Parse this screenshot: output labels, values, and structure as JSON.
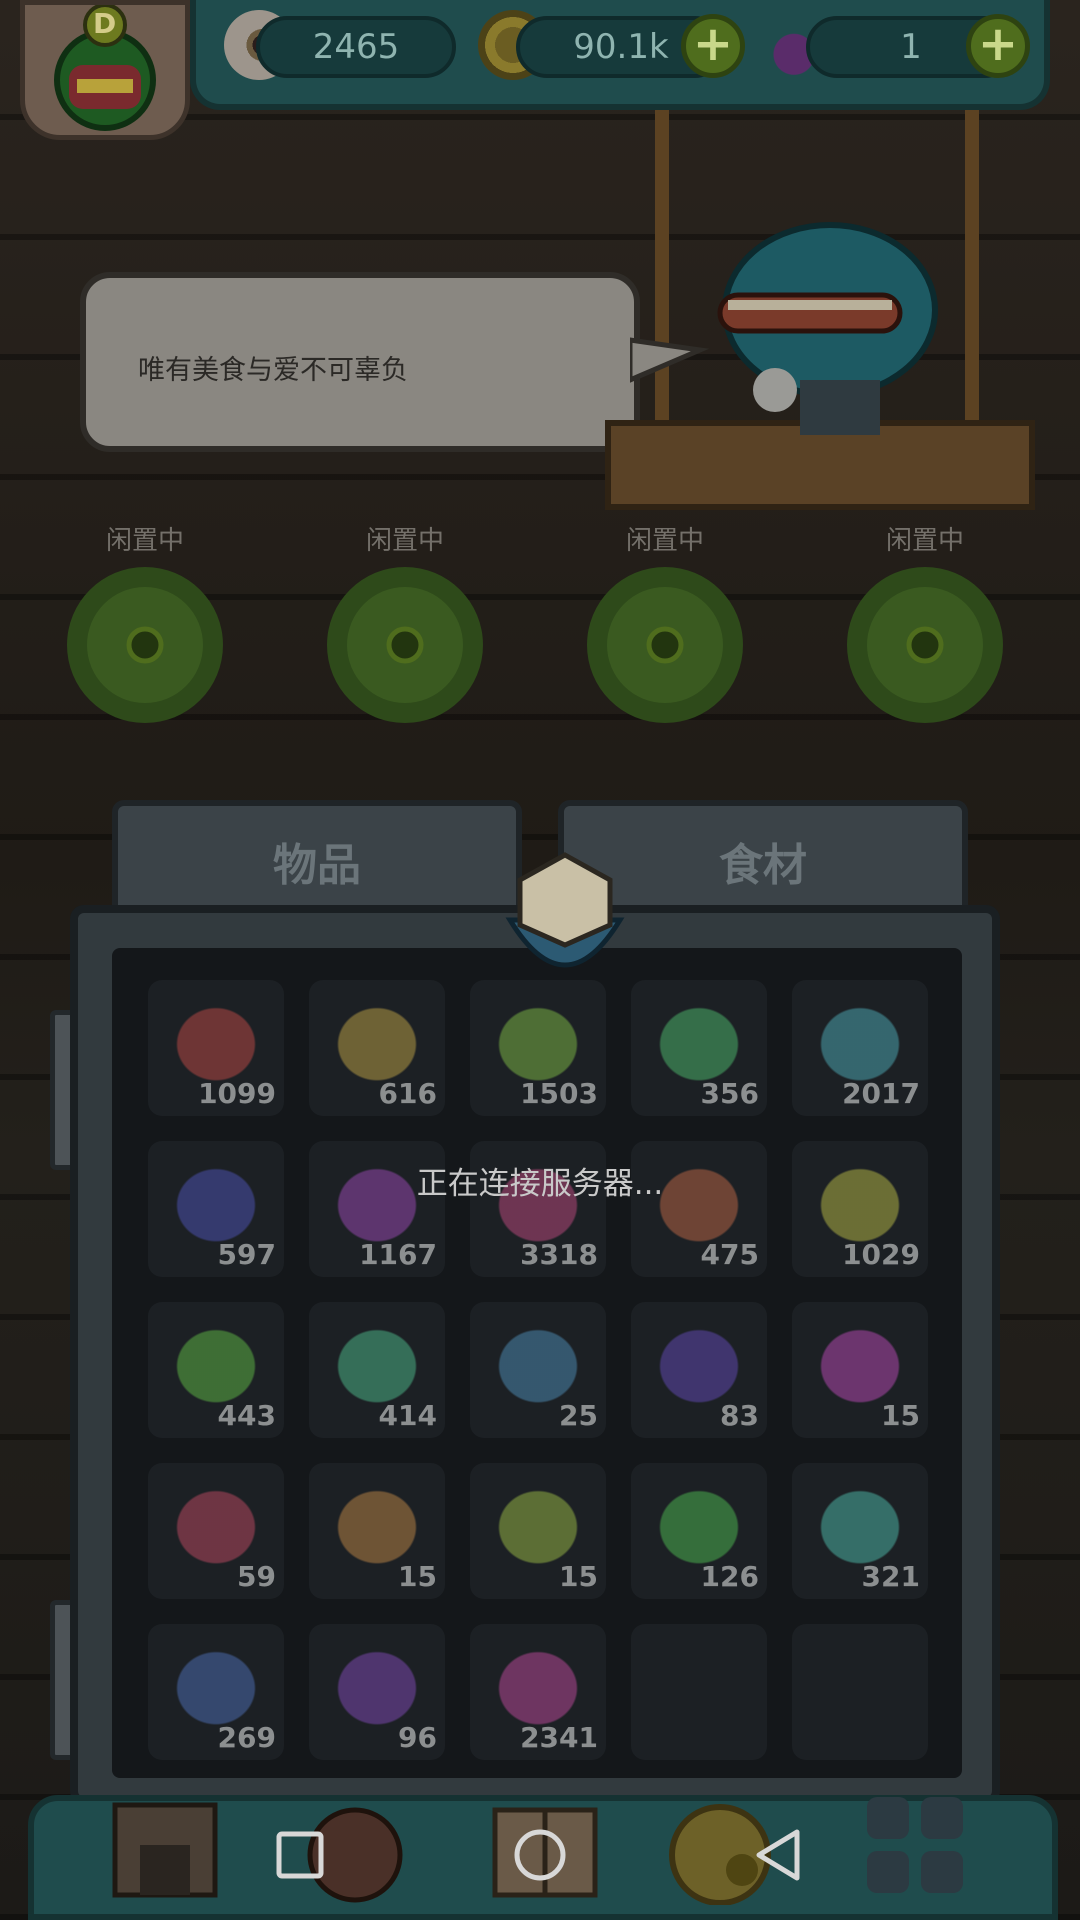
{
  "resources": {
    "eyes": "2465",
    "coins": "90.1k",
    "potions": "1",
    "plus_symbol": "+"
  },
  "avatar": {
    "rank_letter": "D"
  },
  "dialogue": {
    "text": "唯有美食与爱不可辜负"
  },
  "stations": [
    {
      "status": "闲置中"
    },
    {
      "status": "闲置中"
    },
    {
      "status": "闲置中"
    },
    {
      "status": "闲置中"
    }
  ],
  "tabs": {
    "items": "物品",
    "ingredients": "食材"
  },
  "ingredients": [
    {
      "icon": "corn-icon",
      "count": "1099"
    },
    {
      "icon": "carrot-icon",
      "count": "616"
    },
    {
      "icon": "egg-icon",
      "count": "1503"
    },
    {
      "icon": "salmon-icon",
      "count": "356"
    },
    {
      "icon": "lettuce-icon",
      "count": "2017"
    },
    {
      "icon": "tomato-icon",
      "count": "597"
    },
    {
      "icon": "mushroom-icon",
      "count": "1167"
    },
    {
      "icon": "flour-icon",
      "count": "3318"
    },
    {
      "icon": "potato-icon",
      "count": "475"
    },
    {
      "icon": "drumstick-icon",
      "count": "1029"
    },
    {
      "icon": "ham-icon",
      "count": "443"
    },
    {
      "icon": "pumpkin-icon",
      "count": "414"
    },
    {
      "icon": "steak-icon",
      "count": "25"
    },
    {
      "icon": "onion-icon",
      "count": "83"
    },
    {
      "icon": "radish-icon",
      "count": "15"
    },
    {
      "icon": "milk-icon",
      "count": "59"
    },
    {
      "icon": "ginseng-icon",
      "count": "15"
    },
    {
      "icon": "shell-icon",
      "count": "15"
    },
    {
      "icon": "oyster-icon",
      "count": "126"
    },
    {
      "icon": "cucumber-icon",
      "count": "321"
    },
    {
      "icon": "melon-icon",
      "count": "269"
    },
    {
      "icon": "broccoli-icon",
      "count": "96"
    },
    {
      "icon": "rice-icon",
      "count": "2341"
    },
    {
      "icon": "",
      "count": ""
    },
    {
      "icon": "",
      "count": ""
    }
  ],
  "loading": {
    "text": "正在连接服务器..."
  },
  "colors": {
    "teal_bar": "#1f4c4d",
    "panel": "#323a3e",
    "accent_green": "#4f6d1d"
  }
}
